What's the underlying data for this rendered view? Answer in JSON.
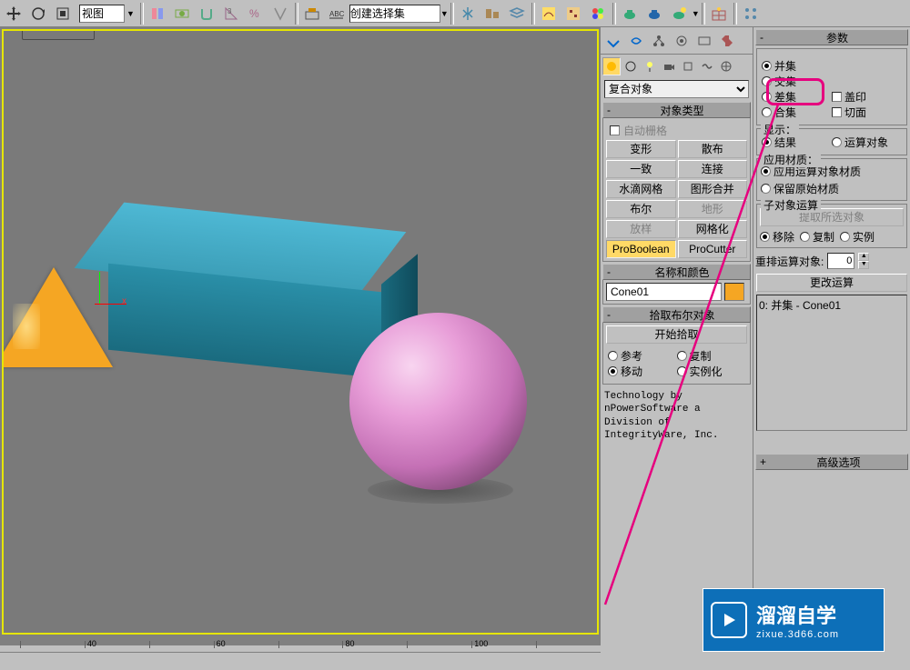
{
  "toolbar": {
    "view_label": "视图",
    "selection_set": "创建选择集"
  },
  "left_panel": {
    "dropdown_value": "复合对象",
    "object_type": {
      "title": "对象类型",
      "auto_grid": "自动栅格",
      "buttons": {
        "morph": "变形",
        "scatter": "散布",
        "conform": "一致",
        "connect": "连接",
        "blobmesh": "水滴网格",
        "shapemerge": "图形合并",
        "boolean": "布尔",
        "terrain": "地形",
        "loft": "放样",
        "mesher": "网格化",
        "proboolean": "ProBoolean",
        "procutter": "ProCutter"
      }
    },
    "name_color": {
      "title": "名称和颜色",
      "name_value": "Cone01"
    },
    "pick_boolean": {
      "title": "拾取布尔对象",
      "start_pick": "开始拾取",
      "reference": "参考",
      "copy": "复制",
      "move": "移动",
      "instance": "实例化"
    },
    "tech_text": "Technology by nPowerSoftware\na Division of IntegrityWare, Inc."
  },
  "right_panel": {
    "params_title": "参数",
    "operation": {
      "union": "并集",
      "intersection": "交集",
      "subtraction": "差集",
      "merge": "合集",
      "imprint": "盖印",
      "cookie": "切面"
    },
    "display": {
      "title": "显示：",
      "result": "结果",
      "operands": "运算对象"
    },
    "material": {
      "title": "应用材质：",
      "apply_operand": "应用运算对象材质",
      "retain_orig": "保留原始材质"
    },
    "sub_obj": {
      "title": "子对象运算",
      "extract_sel": "提取所选对象",
      "remove": "移除",
      "copy": "复制",
      "inst": "实例"
    },
    "reorder": {
      "label": "重排运算对象:",
      "value": "0"
    },
    "change_op": "更改运算",
    "list_item": "0: 并集 - Cone01",
    "advanced_title": "高级选项"
  },
  "ruler": {
    "ticks": [
      "40",
      "60",
      "80",
      "100"
    ]
  },
  "watermark": {
    "title": "溜溜自学",
    "sub": "zixue.3d66.com"
  }
}
